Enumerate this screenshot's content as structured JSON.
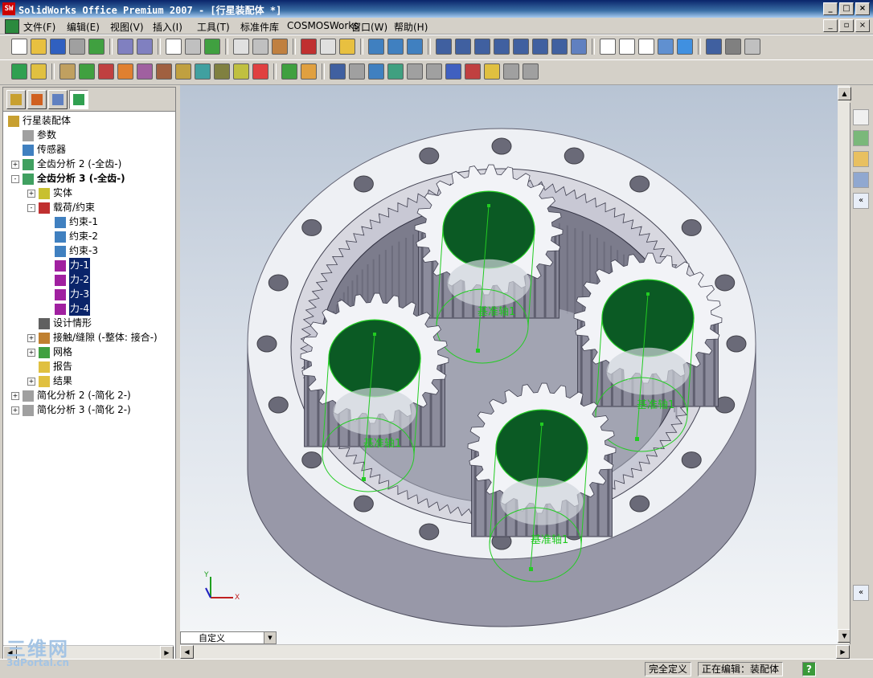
{
  "window": {
    "title": "SolidWorks Office Premium 2007 - [行星装配体 *]",
    "logo_text": "SW",
    "buttons": [
      "_",
      "□",
      "×"
    ]
  },
  "menu": {
    "items": [
      "文件(F)",
      "编辑(E)",
      "视图(V)",
      "插入(I)",
      "工具(T)",
      "标准件库",
      "COSMOSWorks",
      "窗口(W)",
      "帮助(H)"
    ],
    "mdi_buttons": [
      "_",
      "▫",
      "×"
    ]
  },
  "tree": {
    "root": "行星装配体",
    "nodes": [
      {
        "label": "参数",
        "expander": ""
      },
      {
        "label": "传感器",
        "expander": ""
      },
      {
        "label": "全齿分析 2 (-全齿-)",
        "expander": "+"
      },
      {
        "label": "全齿分析 3 (-全齿-)",
        "expander": "-"
      },
      {
        "label": "实体",
        "expander": "+"
      },
      {
        "label": "载荷/约束",
        "expander": "-"
      },
      {
        "label": "约束-1",
        "expander": ""
      },
      {
        "label": "约束-2",
        "expander": ""
      },
      {
        "label": "约束-3",
        "expander": ""
      },
      {
        "label": "力-1",
        "expander": ""
      },
      {
        "label": "力-2",
        "expander": ""
      },
      {
        "label": "力-3",
        "expander": ""
      },
      {
        "label": "力-4",
        "expander": ""
      },
      {
        "label": "设计情形",
        "expander": ""
      },
      {
        "label": "接触/缝隙 (-整体: 接合-)",
        "expander": "+"
      },
      {
        "label": "网格",
        "expander": "+"
      },
      {
        "label": "报告",
        "expander": ""
      },
      {
        "label": "结果",
        "expander": "+"
      },
      {
        "label": "简化分析 2 (-简化 2-)",
        "expander": "+"
      },
      {
        "label": "简化分析 3 (-简化 2-)",
        "expander": "+"
      }
    ]
  },
  "viewport": {
    "axis_labels": [
      "基准轴1",
      "基准轴1",
      "基准轴1",
      "基准轴1"
    ],
    "triad": {
      "x": "X",
      "y": "Y"
    }
  },
  "config": {
    "value": "自定义"
  },
  "status": {
    "defined": "完全定义",
    "editing": "正在编辑：装配体",
    "help": "?"
  },
  "watermark": {
    "brand": "三维网",
    "url": "3dPortal.cn"
  },
  "colors": {
    "gear": "#b8b8c4",
    "hole": "#0b5a24",
    "axis": "#22cc22",
    "ring": "#ffffff"
  }
}
